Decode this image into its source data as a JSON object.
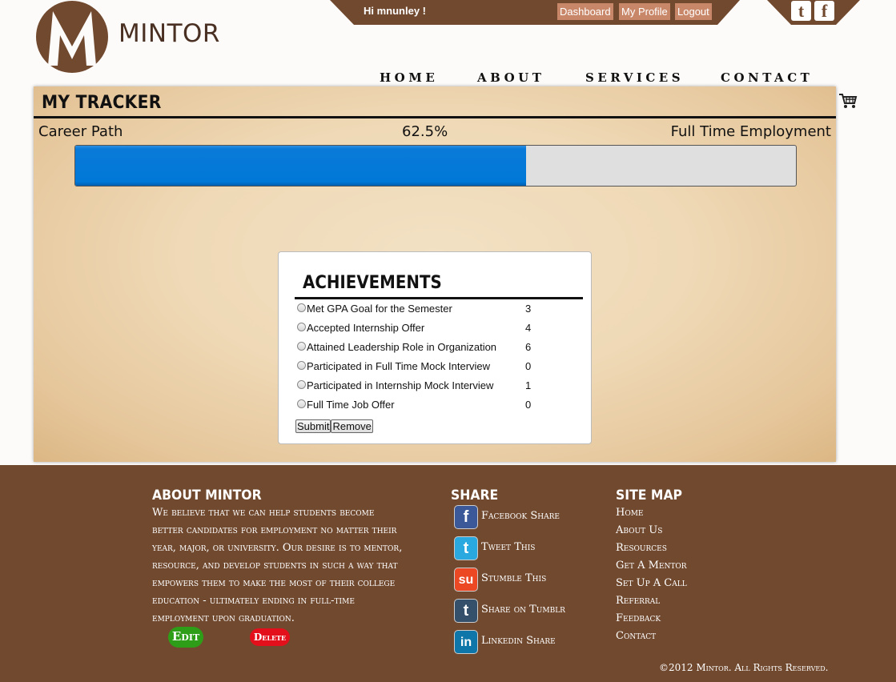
{
  "brand": {
    "name": "MINTOR",
    "logo_letter": "M"
  },
  "user_bar": {
    "greeting": "Hi mnunley !",
    "buttons": [
      "Dashboard",
      "My Profile",
      "Logout"
    ]
  },
  "social_top": {
    "twitter": "t",
    "facebook": "f"
  },
  "nav": [
    "HOME",
    "ABOUT",
    "SERVICES",
    "CONTACT"
  ],
  "tracker": {
    "title": "MY TRACKER",
    "path_label": "Career Path",
    "percent_text": "62.5%",
    "progress_fraction": 0.625,
    "goal_label": "Full Time Employment"
  },
  "achievements": {
    "title": "ACHIEVEMENTS",
    "items": [
      {
        "label": "Met GPA Goal for the Semester",
        "points": "3"
      },
      {
        "label": "Accepted Internship Offer",
        "points": "4"
      },
      {
        "label": "Attained Leadership Role in Organization",
        "points": "6"
      },
      {
        "label": "Participated in Full Time Mock Interview",
        "points": "0"
      },
      {
        "label": "Participated in Internship Mock Interview",
        "points": "1"
      },
      {
        "label": "Full Time Job Offer",
        "points": "0"
      }
    ],
    "submit_label": "Submit",
    "remove_label": "Remove"
  },
  "footer": {
    "about": {
      "heading": "ABOUT MINTOR",
      "text": "We believe that we can help students become better candidates for employment no matter their year, major, or university. Our desire is to mentor, resource, and develop students in such a way that empowers them to make the most of their college education - ultimately ending in full-time employment upon graduation.",
      "edit_label": "Edit",
      "delete_label": "Delete"
    },
    "share": {
      "heading": "SHARE",
      "items": [
        {
          "label": "Facebook Share",
          "glyph": "f",
          "color": "#3b5998"
        },
        {
          "label": "Tweet This",
          "glyph": "t",
          "color": "#2aa9e0"
        },
        {
          "label": "Stumble This",
          "glyph": "su",
          "color": "#eb4823"
        },
        {
          "label": "Share on Tumblr",
          "glyph": "t",
          "color": "#35506b"
        },
        {
          "label": "Linkedin Share",
          "glyph": "in",
          "color": "#0e76a8"
        }
      ]
    },
    "sitemap": {
      "heading": "SITE MAP",
      "items": [
        "Home",
        "About Us",
        "Resources",
        "Get A Mentor",
        "Set Up A Call",
        "Referral",
        "Feedback",
        "Contact"
      ]
    },
    "copyright": "©2012 Mintor. All Rights Reserved."
  },
  "colors": {
    "brown": "#71492f",
    "progress_blue": "#0078d7",
    "edit_green": "#2e9e19",
    "delete_red": "#e3101c"
  }
}
